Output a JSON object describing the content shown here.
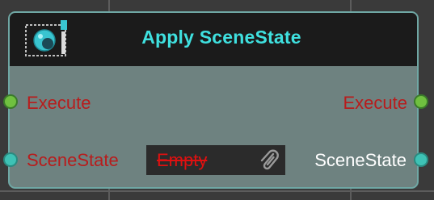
{
  "node": {
    "title": "Apply SceneState",
    "icon": "scene-film-icon",
    "inputs": {
      "execute_label": "Execute",
      "scenestate_label": "SceneState"
    },
    "outputs": {
      "execute_label": "Execute",
      "scenestate_label": "SceneState"
    },
    "value_field": {
      "value": "Empty",
      "icon": "paperclip-icon"
    }
  },
  "colors": {
    "title": "#3fe0df",
    "input_label": "#b81c1c",
    "output_execute_label": "#b81c1c",
    "output_scenestate_label": "#ffffff",
    "exec_pin": "#70c040",
    "data_pin": "#3ec2b5",
    "node_border": "#6fa7a4",
    "node_body": "#6e8280",
    "header": "#1b1b1b",
    "value_text": "#e01010"
  }
}
